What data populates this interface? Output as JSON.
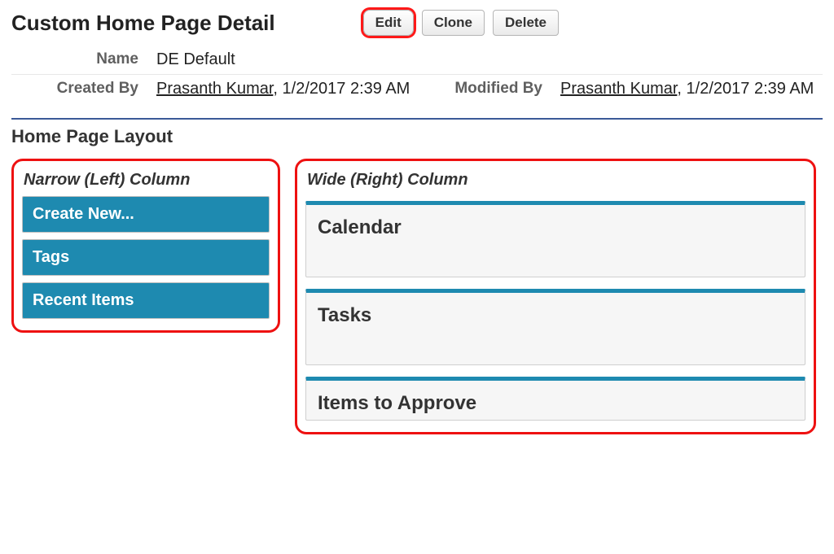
{
  "header": {
    "title": "Custom Home Page Detail",
    "buttons": {
      "edit": "Edit",
      "clone": "Clone",
      "delete": "Delete"
    }
  },
  "details": {
    "name_label": "Name",
    "name_value": "DE Default",
    "created_label": "Created By",
    "created_link": "Prasanth Kumar",
    "created_tail": ", 1/2/2017 2:39 AM",
    "modified_label": "Modified By",
    "modified_link": "Prasanth Kumar",
    "modified_tail": ", 1/2/2017 2:39 AM"
  },
  "section_title": "Home Page Layout",
  "narrow": {
    "heading": "Narrow (Left) Column",
    "items": [
      "Create New...",
      "Tags",
      "Recent Items"
    ]
  },
  "wide": {
    "heading": "Wide (Right) Column",
    "items": [
      "Calendar",
      "Tasks",
      "Items to Approve"
    ]
  }
}
